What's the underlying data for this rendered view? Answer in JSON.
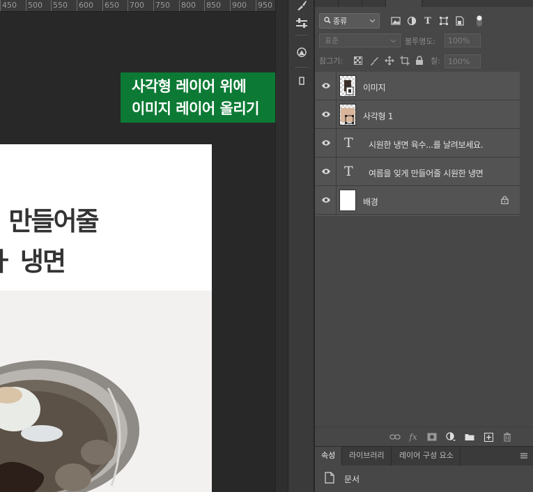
{
  "ruler": {
    "ticks": [
      "450",
      "500",
      "550",
      "600",
      "650",
      "700",
      "750",
      "800",
      "850",
      "900",
      "950"
    ]
  },
  "canvas": {
    "headline_line1": "| 만들어줄",
    "headline_line2": "ㅏ 냉면"
  },
  "annotation": {
    "line1": "사각형 레이어 위에",
    "line2": "이미지 레이어 올리기",
    "color": "#0c7a35"
  },
  "layers_panel": {
    "filter": {
      "kind": "종류"
    },
    "blend_mode": "표준",
    "opacity_label": "불투명도:",
    "opacity_value": "100%",
    "lock_label": "잠그기:",
    "fill_label": "칠:",
    "fill_value": "100%",
    "layers": [
      {
        "name": "이미지",
        "type": "image",
        "visible": true
      },
      {
        "name": "사각형 1",
        "type": "shape",
        "visible": true
      },
      {
        "name": "시원한 냉면 육수...를 날려보세요.",
        "type": "text",
        "visible": true
      },
      {
        "name": "여름을 잊게 만들어줄 시원한 냉면",
        "type": "text",
        "visible": true
      },
      {
        "name": "배경",
        "type": "background",
        "visible": true,
        "locked": true
      }
    ],
    "text_icon": "T",
    "fx_label": "fx"
  },
  "properties_panel": {
    "tabs": [
      "속성",
      "라이브러리",
      "레이어 구성 요소"
    ],
    "active_tab": "속성",
    "doc_label": "문서"
  },
  "colors": {
    "panel": "#474747",
    "canvas_bg": "#282828",
    "annotation": "#0c7a35"
  }
}
